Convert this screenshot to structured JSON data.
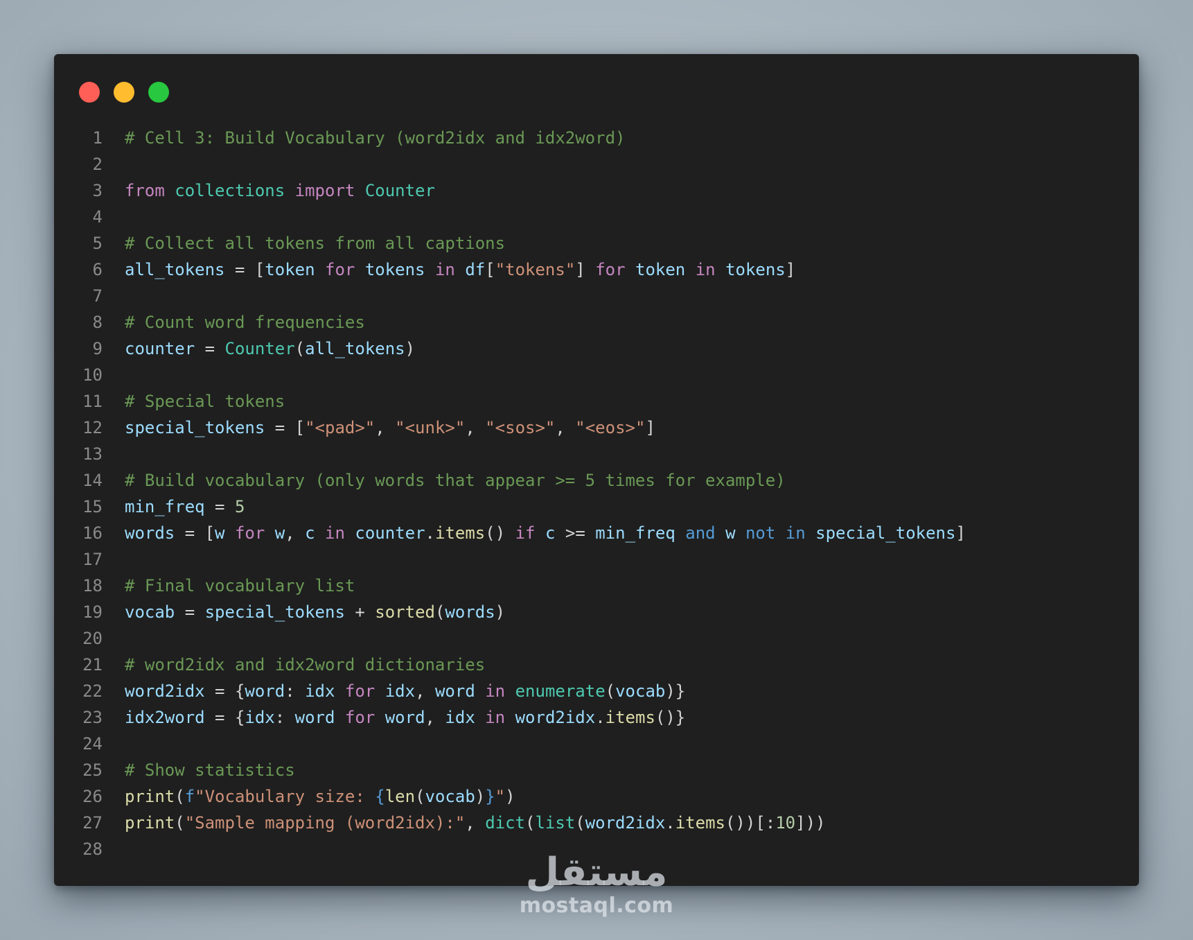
{
  "window": {
    "traffic_lights": [
      {
        "name": "close",
        "color": "#ff5f57"
      },
      {
        "name": "minimize",
        "color": "#febc2e"
      },
      {
        "name": "maximize",
        "color": "#28c840"
      }
    ]
  },
  "code": {
    "lines": [
      {
        "n": "1",
        "tokens": [
          {
            "c": "cm",
            "t": "# Cell 3: Build Vocabulary (word2idx and idx2word)"
          }
        ]
      },
      {
        "n": "2",
        "tokens": []
      },
      {
        "n": "3",
        "tokens": [
          {
            "c": "kw",
            "t": "from"
          },
          {
            "c": "op",
            "t": " "
          },
          {
            "c": "cl",
            "t": "collections"
          },
          {
            "c": "op",
            "t": " "
          },
          {
            "c": "kw",
            "t": "import"
          },
          {
            "c": "op",
            "t": " "
          },
          {
            "c": "cl",
            "t": "Counter"
          }
        ]
      },
      {
        "n": "4",
        "tokens": []
      },
      {
        "n": "5",
        "tokens": [
          {
            "c": "cm",
            "t": "# Collect all tokens from all captions"
          }
        ]
      },
      {
        "n": "6",
        "tokens": [
          {
            "c": "id",
            "t": "all_tokens"
          },
          {
            "c": "op",
            "t": " = ["
          },
          {
            "c": "id",
            "t": "token"
          },
          {
            "c": "op",
            "t": " "
          },
          {
            "c": "kw",
            "t": "for"
          },
          {
            "c": "op",
            "t": " "
          },
          {
            "c": "id",
            "t": "tokens"
          },
          {
            "c": "op",
            "t": " "
          },
          {
            "c": "kw",
            "t": "in"
          },
          {
            "c": "op",
            "t": " "
          },
          {
            "c": "id",
            "t": "df"
          },
          {
            "c": "op",
            "t": "["
          },
          {
            "c": "st",
            "t": "\"tokens\""
          },
          {
            "c": "op",
            "t": "] "
          },
          {
            "c": "kw",
            "t": "for"
          },
          {
            "c": "op",
            "t": " "
          },
          {
            "c": "id",
            "t": "token"
          },
          {
            "c": "op",
            "t": " "
          },
          {
            "c": "kw",
            "t": "in"
          },
          {
            "c": "op",
            "t": " "
          },
          {
            "c": "id",
            "t": "tokens"
          },
          {
            "c": "op",
            "t": "]"
          }
        ]
      },
      {
        "n": "7",
        "tokens": []
      },
      {
        "n": "8",
        "tokens": [
          {
            "c": "cm",
            "t": "# Count word frequencies"
          }
        ]
      },
      {
        "n": "9",
        "tokens": [
          {
            "c": "id",
            "t": "counter"
          },
          {
            "c": "op",
            "t": " = "
          },
          {
            "c": "cl",
            "t": "Counter"
          },
          {
            "c": "op",
            "t": "("
          },
          {
            "c": "id",
            "t": "all_tokens"
          },
          {
            "c": "op",
            "t": ")"
          }
        ]
      },
      {
        "n": "10",
        "tokens": []
      },
      {
        "n": "11",
        "tokens": [
          {
            "c": "cm",
            "t": "# Special tokens"
          }
        ]
      },
      {
        "n": "12",
        "tokens": [
          {
            "c": "id",
            "t": "special_tokens"
          },
          {
            "c": "op",
            "t": " = ["
          },
          {
            "c": "st",
            "t": "\"<pad>\""
          },
          {
            "c": "op",
            "t": ", "
          },
          {
            "c": "st",
            "t": "\"<unk>\""
          },
          {
            "c": "op",
            "t": ", "
          },
          {
            "c": "st",
            "t": "\"<sos>\""
          },
          {
            "c": "op",
            "t": ", "
          },
          {
            "c": "st",
            "t": "\"<eos>\""
          },
          {
            "c": "op",
            "t": "]"
          }
        ]
      },
      {
        "n": "13",
        "tokens": []
      },
      {
        "n": "14",
        "tokens": [
          {
            "c": "cm",
            "t": "# Build vocabulary (only words that appear >= 5 times for example)"
          }
        ]
      },
      {
        "n": "15",
        "tokens": [
          {
            "c": "id",
            "t": "min_freq"
          },
          {
            "c": "op",
            "t": " = "
          },
          {
            "c": "nu",
            "t": "5"
          }
        ]
      },
      {
        "n": "16",
        "tokens": [
          {
            "c": "id",
            "t": "words"
          },
          {
            "c": "op",
            "t": " = ["
          },
          {
            "c": "id",
            "t": "w"
          },
          {
            "c": "op",
            "t": " "
          },
          {
            "c": "kw",
            "t": "for"
          },
          {
            "c": "op",
            "t": " "
          },
          {
            "c": "id",
            "t": "w"
          },
          {
            "c": "op",
            "t": ", "
          },
          {
            "c": "id",
            "t": "c"
          },
          {
            "c": "op",
            "t": " "
          },
          {
            "c": "kw",
            "t": "in"
          },
          {
            "c": "op",
            "t": " "
          },
          {
            "c": "id",
            "t": "counter"
          },
          {
            "c": "op",
            "t": "."
          },
          {
            "c": "fn",
            "t": "items"
          },
          {
            "c": "op",
            "t": "() "
          },
          {
            "c": "kw",
            "t": "if"
          },
          {
            "c": "op",
            "t": " "
          },
          {
            "c": "id",
            "t": "c"
          },
          {
            "c": "op",
            "t": " >= "
          },
          {
            "c": "id",
            "t": "min_freq"
          },
          {
            "c": "op",
            "t": " "
          },
          {
            "c": "kb",
            "t": "and"
          },
          {
            "c": "op",
            "t": " "
          },
          {
            "c": "id",
            "t": "w"
          },
          {
            "c": "op",
            "t": " "
          },
          {
            "c": "kb",
            "t": "not"
          },
          {
            "c": "op",
            "t": " "
          },
          {
            "c": "kb",
            "t": "in"
          },
          {
            "c": "op",
            "t": " "
          },
          {
            "c": "id",
            "t": "special_tokens"
          },
          {
            "c": "op",
            "t": "]"
          }
        ]
      },
      {
        "n": "17",
        "tokens": []
      },
      {
        "n": "18",
        "tokens": [
          {
            "c": "cm",
            "t": "# Final vocabulary list"
          }
        ]
      },
      {
        "n": "19",
        "tokens": [
          {
            "c": "id",
            "t": "vocab"
          },
          {
            "c": "op",
            "t": " = "
          },
          {
            "c": "id",
            "t": "special_tokens"
          },
          {
            "c": "op",
            "t": " + "
          },
          {
            "c": "fn",
            "t": "sorted"
          },
          {
            "c": "op",
            "t": "("
          },
          {
            "c": "id",
            "t": "words"
          },
          {
            "c": "op",
            "t": ")"
          }
        ]
      },
      {
        "n": "20",
        "tokens": []
      },
      {
        "n": "21",
        "tokens": [
          {
            "c": "cm",
            "t": "# word2idx and idx2word dictionaries"
          }
        ]
      },
      {
        "n": "22",
        "tokens": [
          {
            "c": "id",
            "t": "word2idx"
          },
          {
            "c": "op",
            "t": " = {"
          },
          {
            "c": "id",
            "t": "word"
          },
          {
            "c": "op",
            "t": ": "
          },
          {
            "c": "id",
            "t": "idx"
          },
          {
            "c": "op",
            "t": " "
          },
          {
            "c": "kw",
            "t": "for"
          },
          {
            "c": "op",
            "t": " "
          },
          {
            "c": "id",
            "t": "idx"
          },
          {
            "c": "op",
            "t": ", "
          },
          {
            "c": "id",
            "t": "word"
          },
          {
            "c": "op",
            "t": " "
          },
          {
            "c": "kw",
            "t": "in"
          },
          {
            "c": "op",
            "t": " "
          },
          {
            "c": "cl",
            "t": "enumerate"
          },
          {
            "c": "op",
            "t": "("
          },
          {
            "c": "id",
            "t": "vocab"
          },
          {
            "c": "op",
            "t": ")}"
          }
        ]
      },
      {
        "n": "23",
        "tokens": [
          {
            "c": "id",
            "t": "idx2word"
          },
          {
            "c": "op",
            "t": " = {"
          },
          {
            "c": "id",
            "t": "idx"
          },
          {
            "c": "op",
            "t": ": "
          },
          {
            "c": "id",
            "t": "word"
          },
          {
            "c": "op",
            "t": " "
          },
          {
            "c": "kw",
            "t": "for"
          },
          {
            "c": "op",
            "t": " "
          },
          {
            "c": "id",
            "t": "word"
          },
          {
            "c": "op",
            "t": ", "
          },
          {
            "c": "id",
            "t": "idx"
          },
          {
            "c": "op",
            "t": " "
          },
          {
            "c": "kw",
            "t": "in"
          },
          {
            "c": "op",
            "t": " "
          },
          {
            "c": "id",
            "t": "word2idx"
          },
          {
            "c": "op",
            "t": "."
          },
          {
            "c": "fn",
            "t": "items"
          },
          {
            "c": "op",
            "t": "()}"
          }
        ]
      },
      {
        "n": "24",
        "tokens": []
      },
      {
        "n": "25",
        "tokens": [
          {
            "c": "cm",
            "t": "# Show statistics"
          }
        ]
      },
      {
        "n": "26",
        "tokens": [
          {
            "c": "fn",
            "t": "print"
          },
          {
            "c": "op",
            "t": "("
          },
          {
            "c": "kb",
            "t": "f"
          },
          {
            "c": "st",
            "t": "\"Vocabulary size: "
          },
          {
            "c": "kb",
            "t": "{"
          },
          {
            "c": "fn",
            "t": "len"
          },
          {
            "c": "op",
            "t": "("
          },
          {
            "c": "id",
            "t": "vocab"
          },
          {
            "c": "op",
            "t": ")"
          },
          {
            "c": "kb",
            "t": "}"
          },
          {
            "c": "st",
            "t": "\""
          },
          {
            "c": "op",
            "t": ")"
          }
        ]
      },
      {
        "n": "27",
        "tokens": [
          {
            "c": "fn",
            "t": "print"
          },
          {
            "c": "op",
            "t": "("
          },
          {
            "c": "st",
            "t": "\"Sample mapping (word2idx):\""
          },
          {
            "c": "op",
            "t": ", "
          },
          {
            "c": "cl",
            "t": "dict"
          },
          {
            "c": "op",
            "t": "("
          },
          {
            "c": "cl",
            "t": "list"
          },
          {
            "c": "op",
            "t": "("
          },
          {
            "c": "id",
            "t": "word2idx"
          },
          {
            "c": "op",
            "t": "."
          },
          {
            "c": "fn",
            "t": "items"
          },
          {
            "c": "op",
            "t": "())[:"
          },
          {
            "c": "nu",
            "t": "10"
          },
          {
            "c": "op",
            "t": "]))"
          }
        ]
      },
      {
        "n": "28",
        "tokens": []
      }
    ]
  },
  "watermark": {
    "arabic": "مستقل",
    "latin": "mostaql.com"
  }
}
